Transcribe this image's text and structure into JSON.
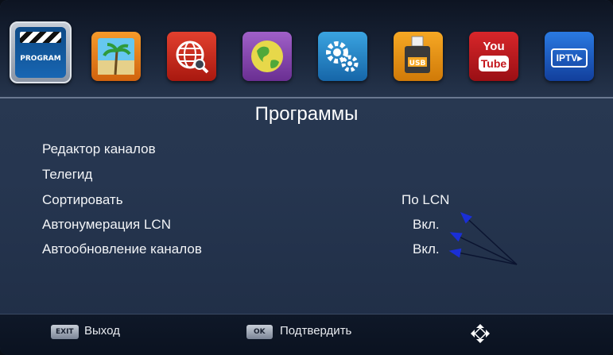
{
  "topbar": {
    "icons": [
      {
        "name": "program",
        "label": "PROGRAM",
        "active": true
      },
      {
        "name": "media-player",
        "active": false,
        "color": "#e07a1a"
      },
      {
        "name": "network",
        "active": false,
        "color": "#c2261e"
      },
      {
        "name": "globe",
        "active": false,
        "color": "#7a3c9c"
      },
      {
        "name": "settings",
        "active": false,
        "color": "#1e86c8"
      },
      {
        "name": "usb",
        "active": false,
        "color": "#e89414"
      },
      {
        "name": "youtube",
        "top": "You",
        "bottom": "Tube",
        "active": false,
        "color": "#c4161c"
      },
      {
        "name": "iptv",
        "label": "IPTV▸",
        "active": false,
        "color": "#1c5dc8"
      }
    ]
  },
  "page": {
    "title": "Программы"
  },
  "menu": {
    "items": [
      {
        "label": "Редактор каналов",
        "value": ""
      },
      {
        "label": "Телегид",
        "value": ""
      },
      {
        "label": "Сортировать",
        "value": "По LCN"
      },
      {
        "label": "Автонумерация LCN",
        "value": "Вкл."
      },
      {
        "label": "Автообновление каналов",
        "value": "Вкл."
      }
    ]
  },
  "footer": {
    "exit_key": "EXIT",
    "exit_label": "Выход",
    "ok_key": "OK",
    "ok_label": "Подтвердить"
  },
  "colors": {
    "background": "#263650",
    "text": "#f2f4f7",
    "annotation_arrow": "#1a2fd6"
  }
}
